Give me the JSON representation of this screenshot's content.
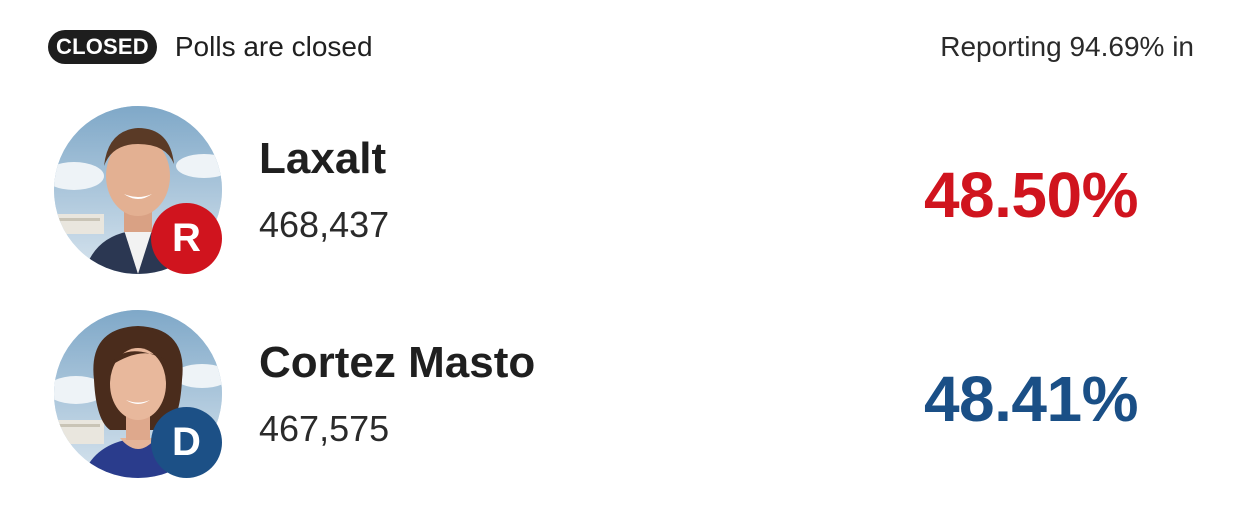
{
  "header": {
    "badge_label": "CLOSED",
    "status_text": "Polls are closed",
    "reporting_text": "Reporting 94.69% in"
  },
  "candidates": [
    {
      "name": "Laxalt",
      "votes": "468,437",
      "percent": "48.50%",
      "party_letter": "R",
      "party_color": "#d0141e",
      "photo_icon": "candidate-photo-laxalt"
    },
    {
      "name": "Cortez Masto",
      "votes": "467,575",
      "percent": "48.41%",
      "party_letter": "D",
      "party_color": "#1a4f86",
      "photo_icon": "candidate-photo-cortez-masto"
    }
  ]
}
